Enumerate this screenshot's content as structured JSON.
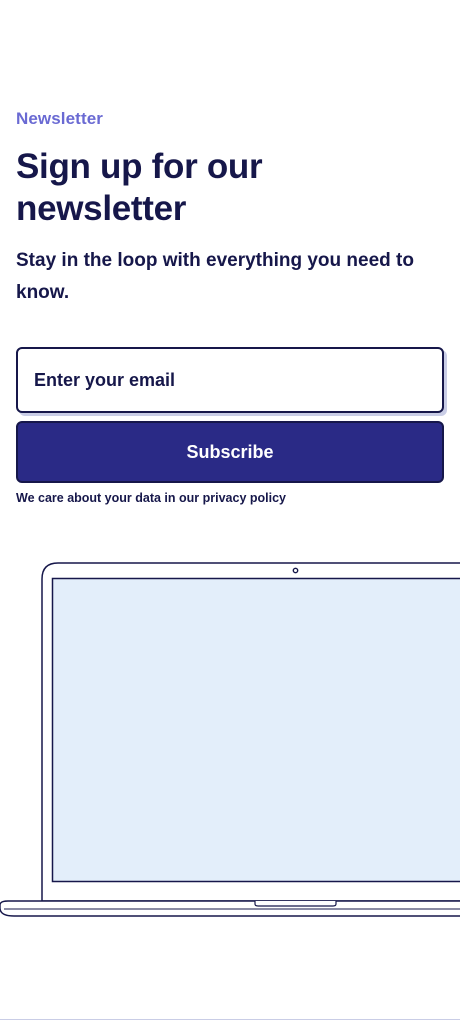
{
  "newsletter": {
    "eyebrow": "Newsletter",
    "title": "Sign up for our newsletter",
    "subtitle": "Stay in the loop with everything you need to know.",
    "email_placeholder": "Enter your email",
    "subscribe_label": "Subscribe",
    "privacy_note": "We care about your data in our privacy policy"
  },
  "illustration": {
    "name": "laptop-illustration",
    "screen_color": "#e3eefa",
    "outline_color": "#16174a"
  },
  "colors": {
    "accent": "#6a6ad3",
    "primary": "#2a2a86",
    "text": "#16174a"
  }
}
